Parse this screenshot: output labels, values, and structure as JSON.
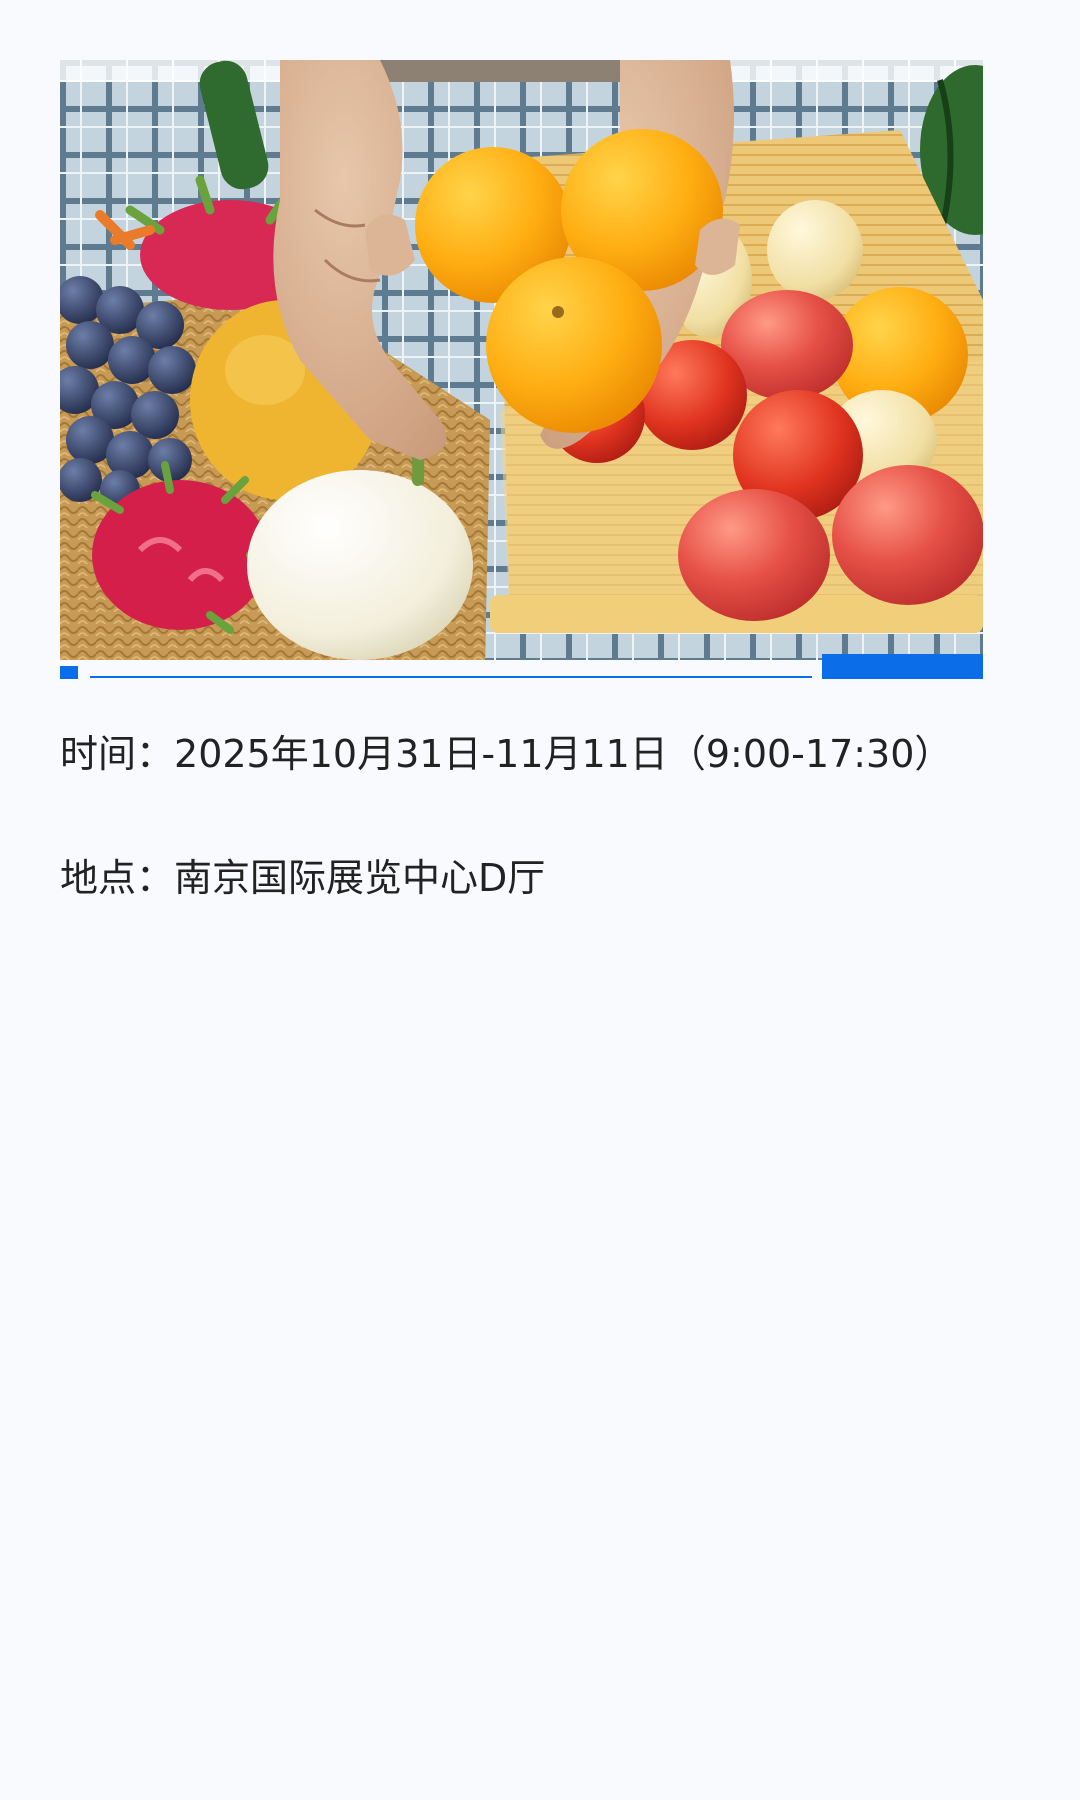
{
  "hero_image": {
    "alt_icon": "fruit-basket-photo"
  },
  "event": {
    "time_label": "时间：",
    "time_value": "2025年10月31日-11月11日（9:00-17:30）",
    "place_label": "地点：",
    "place_value": "南京国际展览中心D厅"
  },
  "colors": {
    "background": "#f8fafd",
    "accent": "#0b6ee8",
    "text": "#222222"
  }
}
